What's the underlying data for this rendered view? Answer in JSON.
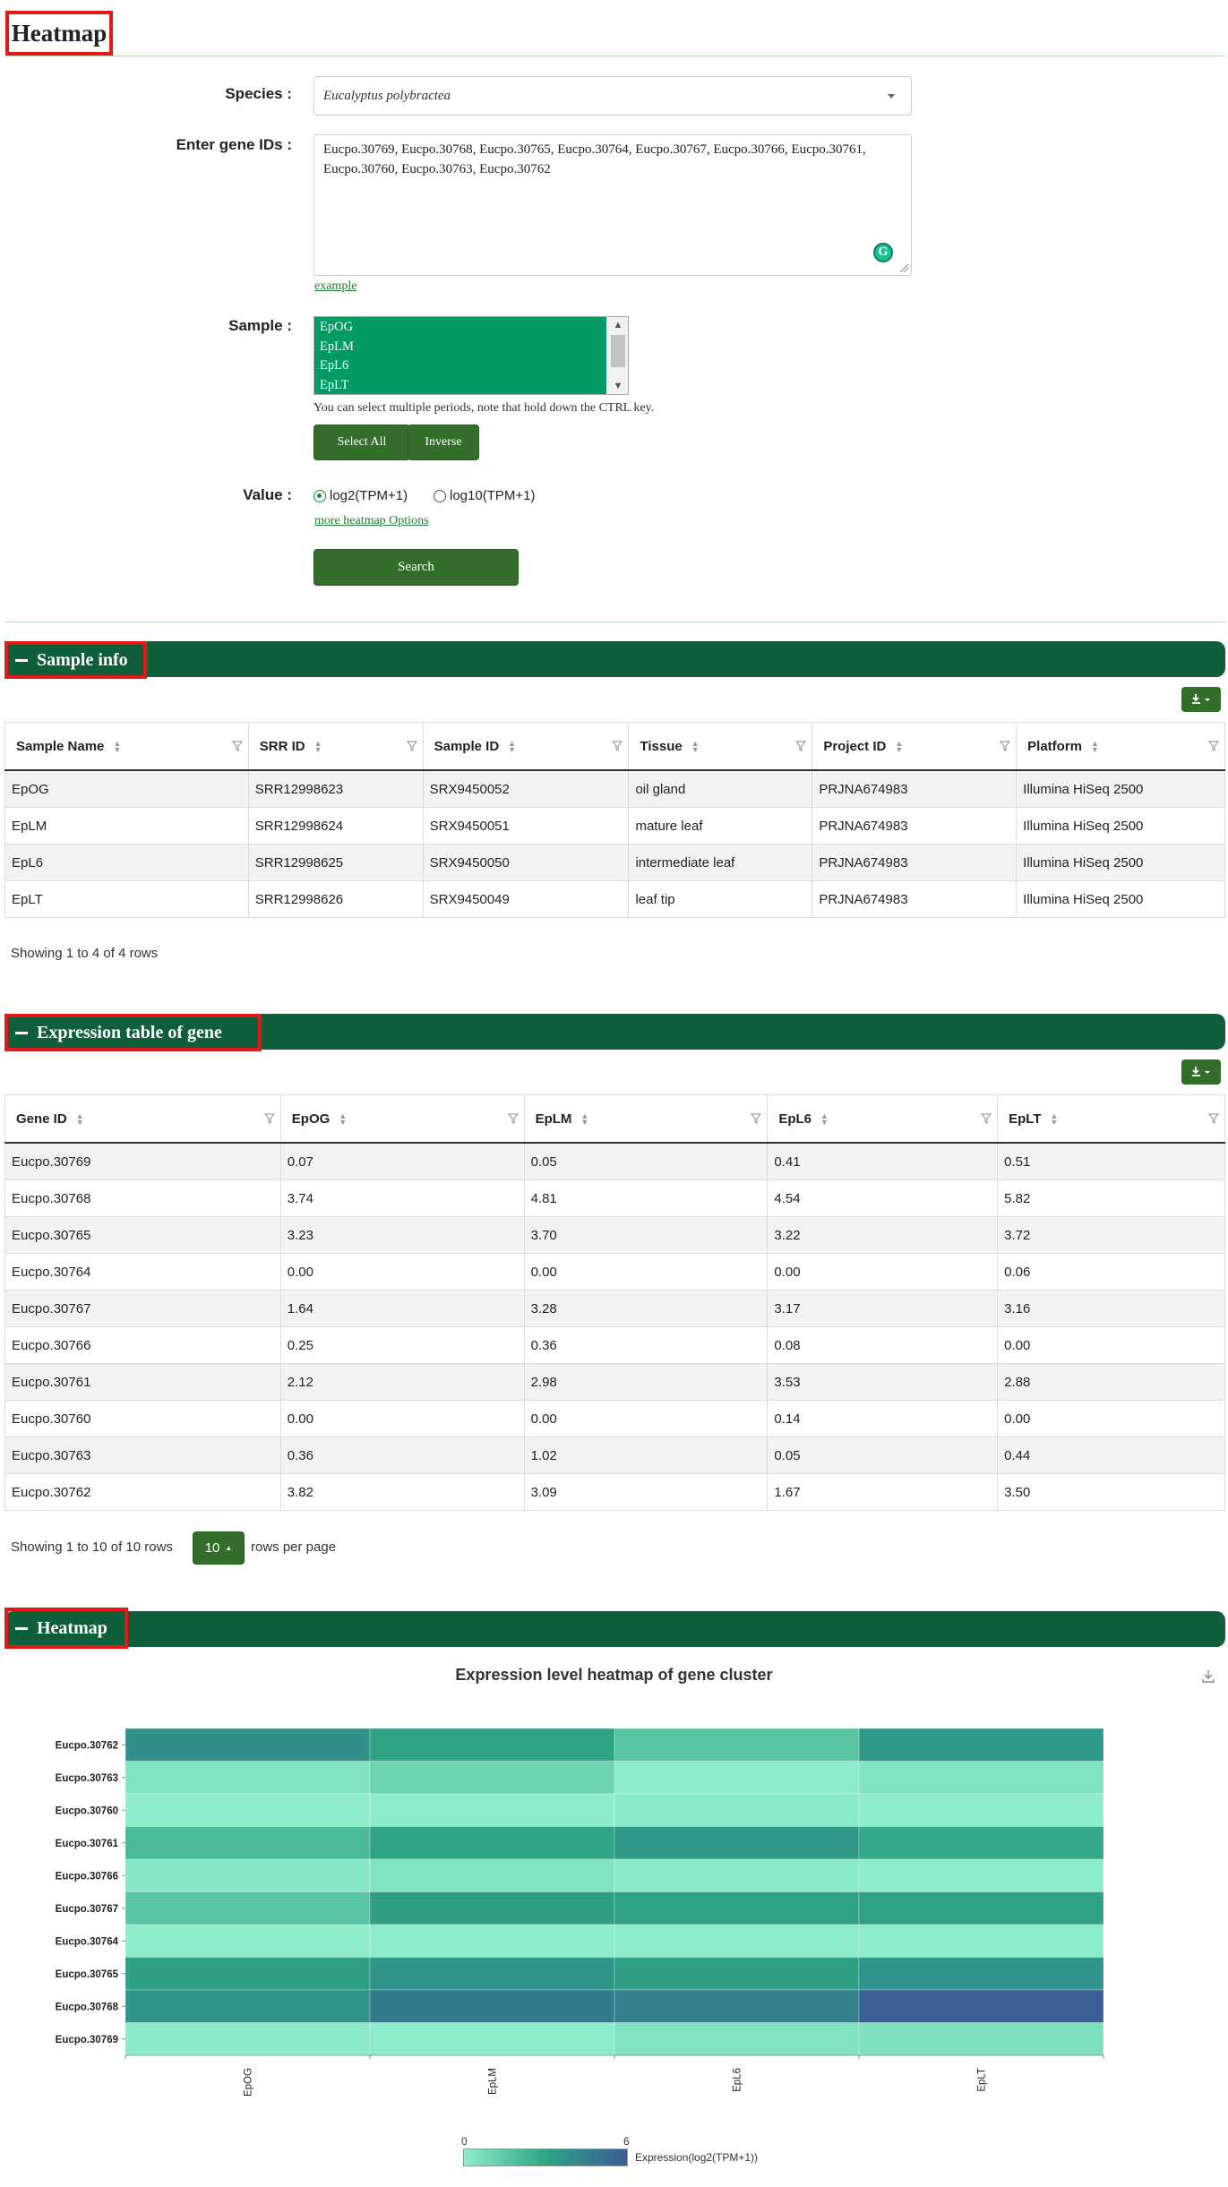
{
  "page_title": "Heatmap",
  "form": {
    "species_label": "Species :",
    "species_value": "Eucalyptus polybractea",
    "gene_ids_label": "Enter gene IDs :",
    "gene_ids_value": "Eucpo.30769, Eucpo.30768, Eucpo.30765, Eucpo.30764, Eucpo.30767, Eucpo.30766, Eucpo.30761, Eucpo.30760, Eucpo.30763, Eucpo.30762",
    "example_link": "example",
    "sample_label": "Sample :",
    "sample_options": [
      "EpOG",
      "EpLM",
      "EpL6",
      "EpLT"
    ],
    "sample_hint": "You can select multiple periods, note that hold down the CTRL key.",
    "select_all_label": "Select All",
    "inverse_label": "Inverse",
    "value_label": "Value :",
    "value_options": [
      "log2(TPM+1)",
      "log10(TPM+1)"
    ],
    "value_selected": "log2(TPM+1)",
    "more_options_link": "more heatmap Options",
    "search_label": "Search"
  },
  "sample_info": {
    "section_title": "Sample info",
    "columns": [
      "Sample Name",
      "SRR ID",
      "Sample ID",
      "Tissue",
      "Project ID",
      "Platform"
    ],
    "rows": [
      [
        "EpOG",
        "SRR12998623",
        "SRX9450052",
        "oil gland",
        "PRJNA674983",
        "Illumina HiSeq 2500"
      ],
      [
        "EpLM",
        "SRR12998624",
        "SRX9450051",
        "mature leaf",
        "PRJNA674983",
        "Illumina HiSeq 2500"
      ],
      [
        "EpL6",
        "SRR12998625",
        "SRX9450050",
        "intermediate leaf",
        "PRJNA674983",
        "Illumina HiSeq 2500"
      ],
      [
        "EpLT",
        "SRR12998626",
        "SRX9450049",
        "leaf tip",
        "PRJNA674983",
        "Illumina HiSeq 2500"
      ]
    ],
    "footer": "Showing 1 to 4 of 4 rows"
  },
  "expression_table": {
    "section_title": "Expression table of gene",
    "columns": [
      "Gene ID",
      "EpOG",
      "EpLM",
      "EpL6",
      "EpLT"
    ],
    "rows": [
      [
        "Eucpo.30769",
        "0.07",
        "0.05",
        "0.41",
        "0.51"
      ],
      [
        "Eucpo.30768",
        "3.74",
        "4.81",
        "4.54",
        "5.82"
      ],
      [
        "Eucpo.30765",
        "3.23",
        "3.70",
        "3.22",
        "3.72"
      ],
      [
        "Eucpo.30764",
        "0.00",
        "0.00",
        "0.00",
        "0.06"
      ],
      [
        "Eucpo.30767",
        "1.64",
        "3.28",
        "3.17",
        "3.16"
      ],
      [
        "Eucpo.30766",
        "0.25",
        "0.36",
        "0.08",
        "0.00"
      ],
      [
        "Eucpo.30761",
        "2.12",
        "2.98",
        "3.53",
        "2.88"
      ],
      [
        "Eucpo.30760",
        "0.00",
        "0.00",
        "0.14",
        "0.00"
      ],
      [
        "Eucpo.30763",
        "0.36",
        "1.02",
        "0.05",
        "0.44"
      ],
      [
        "Eucpo.30762",
        "3.82",
        "3.09",
        "1.67",
        "3.50"
      ]
    ],
    "footer_prefix": "Showing 1 to 10 of 10 rows",
    "page_size": "10",
    "footer_suffix": "rows per page"
  },
  "heatmap_section": {
    "section_title": "Heatmap"
  },
  "chart_data": {
    "type": "heatmap",
    "title": "Expression level heatmap of gene cluster",
    "x": [
      "EpOG",
      "EpLM",
      "EpL6",
      "EpLT"
    ],
    "y": [
      "Eucpo.30762",
      "Eucpo.30763",
      "Eucpo.30760",
      "Eucpo.30761",
      "Eucpo.30766",
      "Eucpo.30767",
      "Eucpo.30764",
      "Eucpo.30765",
      "Eucpo.30768",
      "Eucpo.30769"
    ],
    "values": [
      [
        3.82,
        3.09,
        1.67,
        3.5
      ],
      [
        0.36,
        1.02,
        0.05,
        0.44
      ],
      [
        0.0,
        0.0,
        0.14,
        0.0
      ],
      [
        2.12,
        2.98,
        3.53,
        2.88
      ],
      [
        0.25,
        0.36,
        0.08,
        0.0
      ],
      [
        1.64,
        3.28,
        3.17,
        3.16
      ],
      [
        0.0,
        0.0,
        0.0,
        0.06
      ],
      [
        3.23,
        3.7,
        3.22,
        3.72
      ],
      [
        3.74,
        4.81,
        4.54,
        5.82
      ],
      [
        0.07,
        0.05,
        0.41,
        0.51
      ]
    ],
    "value_range": [
      0,
      6
    ],
    "legend_min": "0",
    "legend_max": "6",
    "legend_title": "Expression(log2(TPM+1))",
    "colors": {
      "low": "#8eeccb",
      "mid": "#2ea585",
      "high": "#3a5c96"
    }
  },
  "colors": {
    "primary_green": "#0f5f3b",
    "button_green": "#336e2b",
    "link_green": "#1f8a46",
    "highlight_red": "#e11919",
    "selected_option": "#029b63"
  }
}
